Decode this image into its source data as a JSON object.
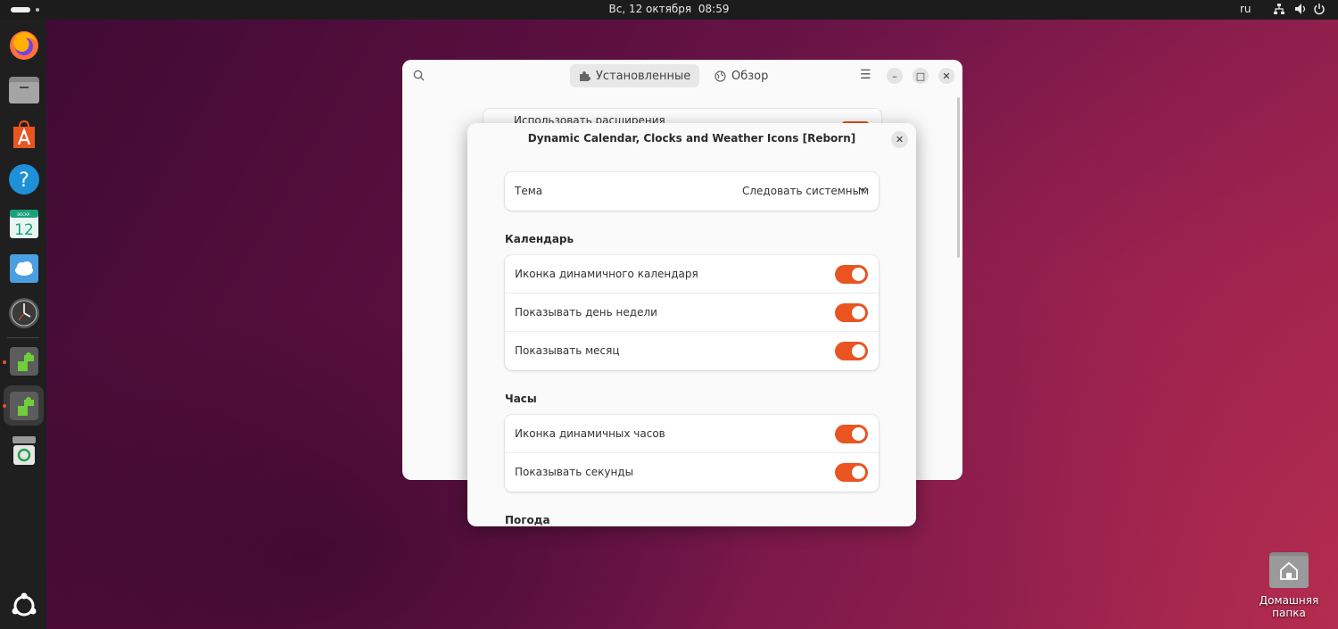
{
  "topbar": {
    "date": "Вс, 12 октября",
    "time": "08:59",
    "keyboard_layout": "ru",
    "tray_icons": [
      "network-icon",
      "volume-icon",
      "power-icon"
    ]
  },
  "dock": {
    "items": [
      {
        "name": "firefox",
        "icon": "firefox-icon"
      },
      {
        "name": "files",
        "icon": "folder-icon"
      },
      {
        "name": "app-center",
        "icon": "app-center-icon"
      },
      {
        "name": "help",
        "icon": "help-icon"
      },
      {
        "name": "calendar",
        "icon": "calendar-icon",
        "text": "12",
        "small_text": "ВОСКР."
      },
      {
        "name": "weather",
        "icon": "weather-icon"
      },
      {
        "name": "clocks",
        "icon": "clock-icon"
      },
      {
        "name": "extensions",
        "icon": "puzzle-icon"
      },
      {
        "name": "extension-manager",
        "icon": "puzzle-icon"
      },
      {
        "name": "trash",
        "icon": "trash-icon"
      },
      {
        "name": "show-apps",
        "icon": "ubuntu-icon"
      }
    ]
  },
  "main_window": {
    "tabs": [
      {
        "label": "Установленные",
        "icon": "puzzle-icon",
        "active": true
      },
      {
        "label": "Обзор",
        "icon": "globe-icon",
        "active": false
      }
    ],
    "background_row_label": "Использовать расширения"
  },
  "dialog": {
    "title": "Dynamic Calendar, Clocks and Weather Icons [Reborn]",
    "theme": {
      "label": "Тема",
      "value": "Следовать системным"
    },
    "sections": {
      "calendar": {
        "title": "Календарь",
        "rows": [
          {
            "label": "Иконка динамичного календаря",
            "enabled": true
          },
          {
            "label": "Показывать день недели",
            "enabled": true
          },
          {
            "label": "Показывать месяц",
            "enabled": true
          }
        ]
      },
      "clock": {
        "title": "Часы",
        "rows": [
          {
            "label": "Иконка динамичных часов",
            "enabled": true
          },
          {
            "label": "Показывать секунды",
            "enabled": true
          }
        ]
      },
      "weather": {
        "title": "Погода"
      }
    }
  },
  "desktop": {
    "home_label": "Домашняя папка"
  },
  "colors": {
    "accent": "#e95420",
    "topbar": "#1c1c1c",
    "dock": "#1f1f1f"
  }
}
